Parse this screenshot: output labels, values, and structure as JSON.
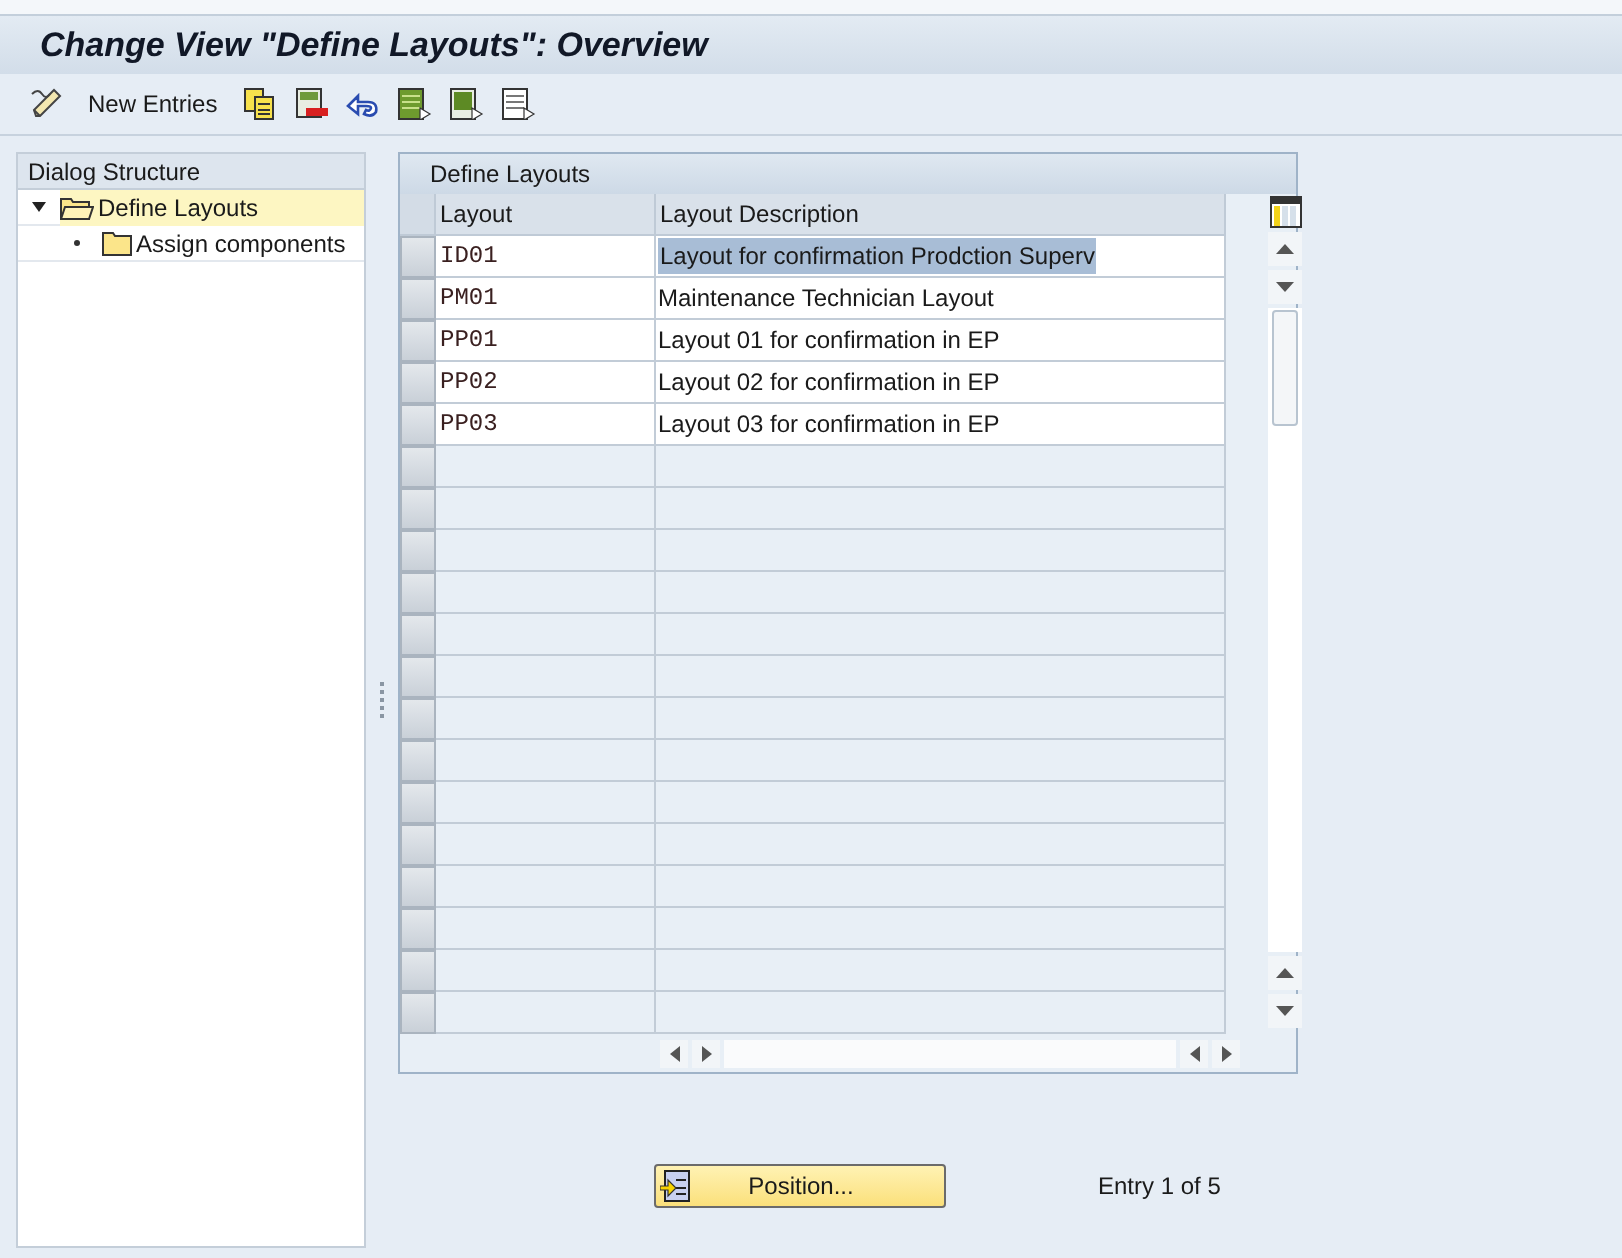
{
  "window": {
    "title": "Change View \"Define Layouts\": Overview"
  },
  "toolbar": [
    {
      "kind": "new",
      "label": "New Entries"
    },
    {
      "kind": "copy"
    },
    {
      "kind": "delete"
    },
    {
      "kind": "undo"
    },
    {
      "kind": "select-all"
    },
    {
      "kind": "select-block"
    },
    {
      "kind": "deselect-all"
    }
  ],
  "dialog_structure": {
    "title": "Dialog Structure",
    "items": [
      {
        "label": "Define Layouts",
        "selected": true,
        "expanded": true,
        "children": [
          {
            "label": "Assign components",
            "selected": false
          }
        ]
      }
    ]
  },
  "table": {
    "title": "Define Layouts",
    "columns": [
      "Layout",
      "Layout Description"
    ],
    "rows": [
      {
        "layout": "ID01",
        "description": "Layout for confirmation Prodction Superv",
        "selected": true
      },
      {
        "layout": "PM01",
        "description": "Maintenance Technician Layout",
        "selected": false
      },
      {
        "layout": "PP01",
        "description": "Layout 01 for confirmation in EP",
        "selected": false
      },
      {
        "layout": "PP02",
        "description": "Layout 02 for confirmation in EP",
        "selected": false
      },
      {
        "layout": "PP03",
        "description": "Layout 03 for confirmation in EP",
        "selected": false
      }
    ]
  },
  "footer": {
    "button": "Position...",
    "entry_info": "Entry 1 of 5"
  }
}
